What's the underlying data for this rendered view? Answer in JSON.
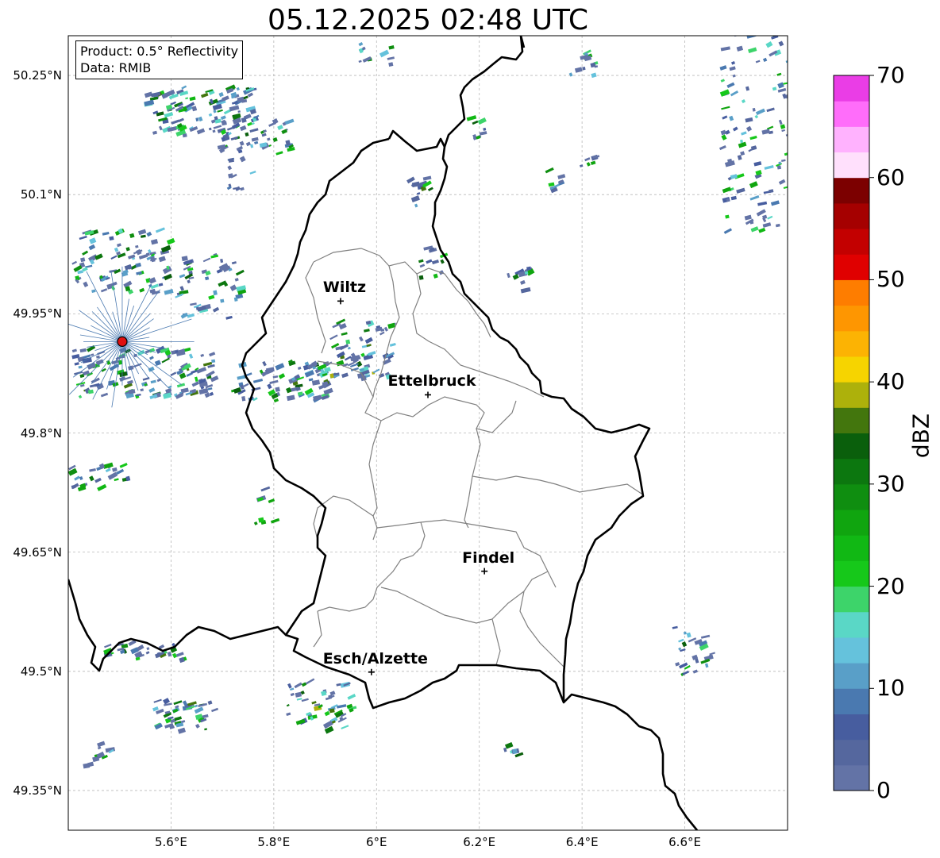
{
  "title": "05.12.2025 02:48 UTC",
  "info": {
    "product": "Product: 0.5° Reflectivity",
    "data": "Data: RMIB"
  },
  "lat_ticks": [
    "50.25°N",
    "50.1°N",
    "49.95°N",
    "49.8°N",
    "49.65°N",
    "49.5°N",
    "49.35°N"
  ],
  "lon_ticks": [
    "5.6°E",
    "5.8°E",
    "6°E",
    "6.2°E",
    "6.4°E",
    "6.6°E"
  ],
  "cities": [
    {
      "name": "Wiltz",
      "lon": 5.93,
      "lat": 49.966
    },
    {
      "name": "Ettelbruck",
      "lon": 6.1,
      "lat": 49.848
    },
    {
      "name": "Findel",
      "lon": 6.21,
      "lat": 49.626
    },
    {
      "name": "Esch/Alzette",
      "lon": 5.99,
      "lat": 49.499
    }
  ],
  "radar_site": {
    "lon": 5.505,
    "lat": 49.915
  },
  "colorbar": {
    "label": "dBZ",
    "ticks": [
      "70",
      "60",
      "50",
      "40",
      "30",
      "20",
      "10",
      "0"
    ],
    "colors": [
      "#6373a6",
      "#55679e",
      "#475d9f",
      "#4a79b0",
      "#599fc8",
      "#65c2dc",
      "#5ad7c6",
      "#3dd46a",
      "#16c81a",
      "#11b814",
      "#10a50f",
      "#0f8e10",
      "#0c770f",
      "#0a5f0c",
      "#43760d",
      "#adb10b",
      "#f6d400",
      "#fcb303",
      "#fe9601",
      "#fe7d00",
      "#e00000",
      "#c30000",
      "#a50000",
      "#7c0000",
      "#ffe0fc",
      "#ffb2fe",
      "#ff6dfa",
      "#ea3de6"
    ]
  },
  "map_extent": {
    "lon": [
      5.4,
      6.8
    ],
    "lat": [
      49.3,
      50.3
    ]
  }
}
